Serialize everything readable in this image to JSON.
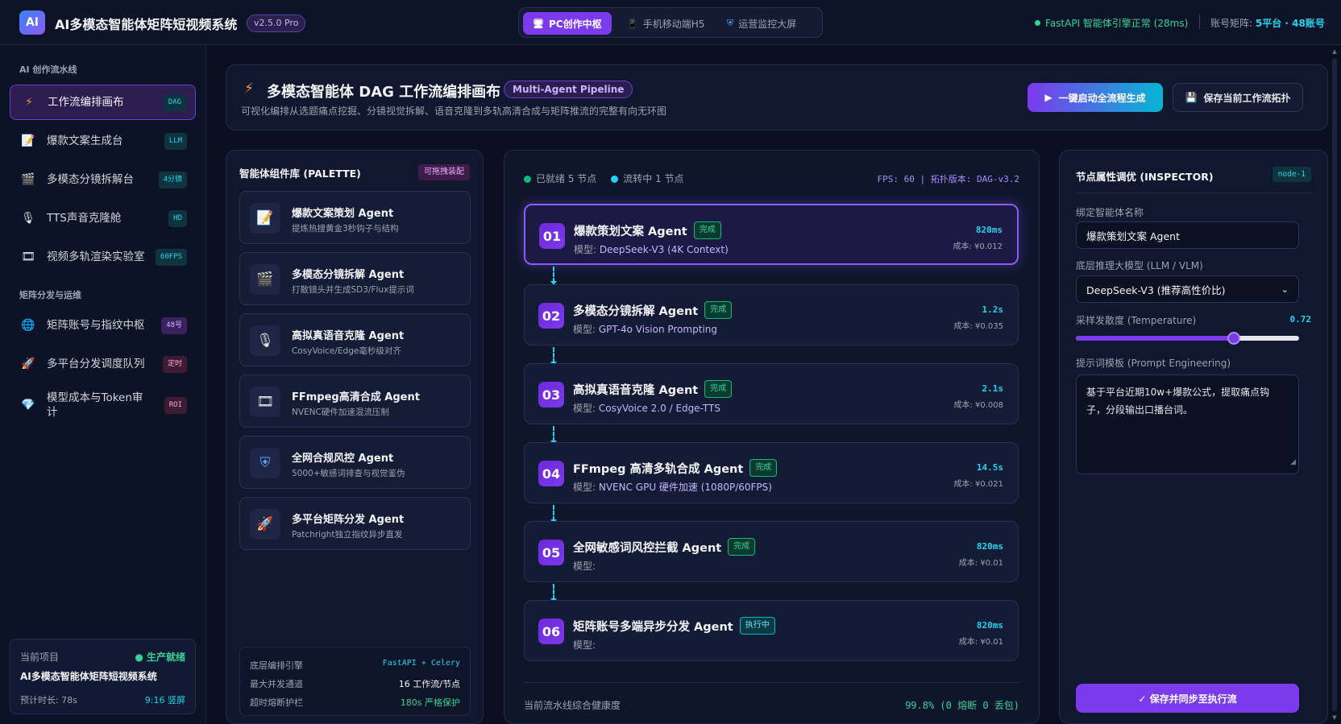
{
  "header": {
    "logo_text": "AI",
    "title": "AI多模态智能体矩阵短视频系统",
    "version": "v2.5.0 Pro",
    "modes": [
      {
        "label": "PC创作中枢",
        "icon": "monitor-icon",
        "active": true
      },
      {
        "label": "手机移动端H5",
        "icon": "mobile-icon",
        "active": false
      },
      {
        "label": "运营监控大屏",
        "icon": "shield-icon",
        "active": false
      }
    ],
    "engine_status": "FastAPI 智能体引擎正常 (28ms)",
    "matrix_label": "账号矩阵: ",
    "matrix_value": "5平台 · 48账号"
  },
  "sidebar": {
    "section1": "AI 创作流水线",
    "section2": "矩阵分发与运维",
    "items": [
      {
        "label": "工作流编排画布",
        "icon": "bolt-icon",
        "badge": "DAG"
      },
      {
        "label": "爆款文案生成台",
        "icon": "document-icon",
        "badge": "LLM"
      },
      {
        "label": "多模态分镜拆解台",
        "icon": "clapper-icon",
        "badge": "4分镜"
      },
      {
        "label": "TTS声音克隆舱",
        "icon": "microphone-icon",
        "badge": "HD"
      },
      {
        "label": "视频多轨渲染实验室",
        "icon": "film-icon",
        "badge": "60FPS"
      },
      {
        "label": "矩阵账号与指纹中枢",
        "icon": "globe-icon",
        "badge": "48号"
      },
      {
        "label": "多平台分发调度队列",
        "icon": "rocket-icon",
        "badge": "定时"
      },
      {
        "label": "模型成本与Token审计",
        "icon": "diamond-icon",
        "badge": "ROI"
      }
    ],
    "project": {
      "key": "当前项目",
      "status": "● 生产就绪",
      "name": "AI多模态智能体矩阵短视频系统",
      "duration": "预计时长: 78s",
      "ratio": "9:16 竖屏"
    }
  },
  "main": {
    "title": "多模态智能体 DAG 工作流编排画布",
    "pill": "Multi-Agent Pipeline",
    "subtitle": "可视化编排从选题痛点挖掘、分镜视觉拆解、语音克隆到多轨高清合成与矩阵推流的完整有向无环图",
    "run_button": "一键启动全流程生成",
    "save_button": "保存当前工作流拓扑"
  },
  "palette": {
    "title": "智能体组件库 (PALETTE)",
    "tag": "可拖拽装配",
    "agents": [
      {
        "name": "爆款文案策划 Agent",
        "desc": "提炼热搜黄金3秒钩子与结构",
        "icon": "document-icon"
      },
      {
        "name": "多模态分镜拆解 Agent",
        "desc": "打散镜头并生成SD3/Flux提示词",
        "icon": "clapper-icon"
      },
      {
        "name": "高拟真语音克隆 Agent",
        "desc": "CosyVoice/Edge毫秒级对齐",
        "icon": "microphone-icon"
      },
      {
        "name": "FFmpeg高清合成 Agent",
        "desc": "NVENC硬件加速混流压制",
        "icon": "film-icon"
      },
      {
        "name": "全网合规风控 Agent",
        "desc": "5000+敏感词排查与视觉鉴伪",
        "icon": "shield-icon"
      },
      {
        "name": "多平台矩阵分发 Agent",
        "desc": "Patchright独立指纹异步直发",
        "icon": "rocket-icon"
      }
    ],
    "footer": [
      {
        "k": "底层编排引擎",
        "v": "FastAPI + Celery"
      },
      {
        "k": "最大并发通道",
        "v": "16 工作流/节点"
      },
      {
        "k": "超时熔断护栏",
        "v": "180s 严格保护"
      }
    ]
  },
  "canvas": {
    "ready": "已就绪 5 节点",
    "running": "流转中 1 节点",
    "meta": "FPS: 60 | 拓扑版本: DAG-v3.2",
    "model_prefix": "模型: ",
    "cost_prefix": "成本: ",
    "nodes": [
      {
        "num": "01",
        "title": "爆款策划文案 Agent",
        "status": "完成",
        "model": "DeepSeek-V3 (4K Context)",
        "time": "820ms",
        "cost": "¥0.012"
      },
      {
        "num": "02",
        "title": "多模态分镜拆解 Agent",
        "status": "完成",
        "model": "GPT-4o Vision Prompting",
        "time": "1.2s",
        "cost": "¥0.035"
      },
      {
        "num": "03",
        "title": "高拟真语音克隆 Agent",
        "status": "完成",
        "model": "CosyVoice 2.0 / Edge-TTS",
        "time": "2.1s",
        "cost": "¥0.008"
      },
      {
        "num": "04",
        "title": "FFmpeg 高清多轨合成 Agent",
        "status": "完成",
        "model": "NVENC GPU 硬件加速 (1080P/60FPS)",
        "time": "14.5s",
        "cost": "¥0.021"
      },
      {
        "num": "05",
        "title": "全网敏感词风控拦截 Agent",
        "status": "完成",
        "model": "",
        "time": "820ms",
        "cost": "¥0.01"
      },
      {
        "num": "06",
        "title": "矩阵账号多端异步分发 Agent",
        "status": "执行中",
        "model": "",
        "time": "820ms",
        "cost": "¥0.01"
      }
    ],
    "health_label": "当前流水线综合健康度",
    "health_value": "99.8% (0 熔断 0 丢包)"
  },
  "inspector": {
    "title": "节点属性调优 (INSPECTOR)",
    "tag": "node-1",
    "name_label": "绑定智能体名称",
    "name_value": "爆款策划文案 Agent",
    "model_label": "底层推理大模型 (LLM / VLM)",
    "model_value": "DeepSeek-V3 (推荐高性价比)",
    "temp_label": "采样发散度 (Temperature)",
    "temp_value": "0.72",
    "temperature": 0.72,
    "prompt_label": "提示词模板 (Prompt Engineering)",
    "prompt_value": "基于平台近期10w+爆款公式，提取痛点钩子，分段输出口播台词。",
    "save_button": "✓ 保存并同步至执行流"
  }
}
